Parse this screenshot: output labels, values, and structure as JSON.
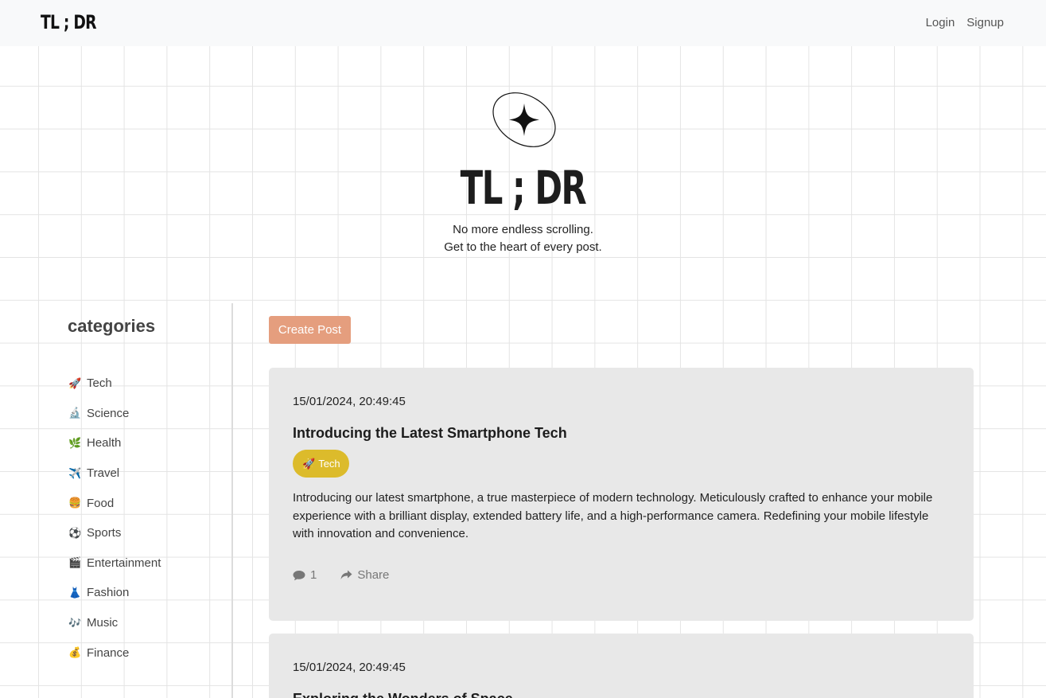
{
  "navbar": {
    "brand": "TL ; DR",
    "login": "Login",
    "signup": "Signup"
  },
  "hero": {
    "title": "TL ; DR",
    "tagline_line1": "No more endless scrolling.",
    "tagline_line2": "Get to the heart of every post."
  },
  "sidebar": {
    "heading": "categories",
    "items": [
      {
        "icon": "🚀",
        "label": "Tech"
      },
      {
        "icon": "🔬",
        "label": "Science"
      },
      {
        "icon": "🌿",
        "label": "Health"
      },
      {
        "icon": "✈️",
        "label": "Travel"
      },
      {
        "icon": "🍔",
        "label": "Food"
      },
      {
        "icon": "⚽",
        "label": "Sports"
      },
      {
        "icon": "🎬",
        "label": "Entertainment"
      },
      {
        "icon": "👗",
        "label": "Fashion"
      },
      {
        "icon": "🎶",
        "label": "Music"
      },
      {
        "icon": "💰",
        "label": "Finance"
      }
    ]
  },
  "main": {
    "create_post": "Create Post",
    "posts": [
      {
        "date": "15/01/2024, 20:49:45",
        "title": "Introducing the Latest Smartphone Tech",
        "tag_icon": "🚀",
        "tag": "Tech",
        "body": "Introducing our latest smartphone, a true masterpiece of modern technology. Meticulously crafted to enhance your mobile experience with a brilliant display, extended battery life, and a high-performance camera. Redefining your mobile lifestyle with innovation and convenience.",
        "comments": "1",
        "share": "Share"
      },
      {
        "date": "15/01/2024, 20:49:45",
        "title": "Exploring the Wonders of Space"
      }
    ]
  },
  "colors": {
    "accent_button": "#e59e7e",
    "tag_tech": "#dcbb2b",
    "card_bg": "#e8e8e8",
    "navbar_bg": "#f8f9fa"
  }
}
